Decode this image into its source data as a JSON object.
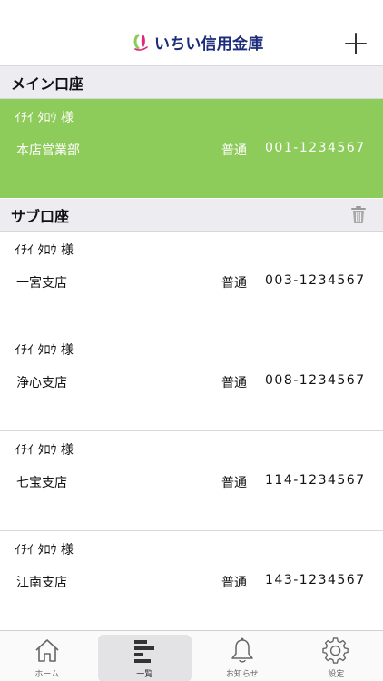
{
  "header": {
    "logo_text": "いちい信用金庫"
  },
  "main_section": {
    "title": "メイン口座",
    "account": {
      "holder": "ｲﾁｲ ﾀﾛｳ 様",
      "branch": "本店営業部",
      "type": "普通",
      "number": "001-1234567"
    }
  },
  "sub_section": {
    "title": "サブ口座",
    "accounts": [
      {
        "holder": "ｲﾁｲ ﾀﾛｳ 様",
        "branch": "一宮支店",
        "type": "普通",
        "number": "003-1234567"
      },
      {
        "holder": "ｲﾁｲ ﾀﾛｳ 様",
        "branch": "浄心支店",
        "type": "普通",
        "number": "008-1234567"
      },
      {
        "holder": "ｲﾁｲ ﾀﾛｳ 様",
        "branch": "七宝支店",
        "type": "普通",
        "number": "114-1234567"
      },
      {
        "holder": "ｲﾁｲ ﾀﾛｳ 様",
        "branch": "江南支店",
        "type": "普通",
        "number": "143-1234567"
      }
    ]
  },
  "tabbar": {
    "tabs": [
      {
        "label": "ホーム",
        "icon": "home-icon"
      },
      {
        "label": "一覧",
        "icon": "list-icon"
      },
      {
        "label": "お知らせ",
        "icon": "bell-icon"
      },
      {
        "label": "設定",
        "icon": "gear-icon"
      }
    ],
    "active_index": 1
  },
  "colors": {
    "main_account_bg": "#8dcb5a",
    "section_header_bg": "#ececf1",
    "logo_text": "#1c2b7a"
  }
}
